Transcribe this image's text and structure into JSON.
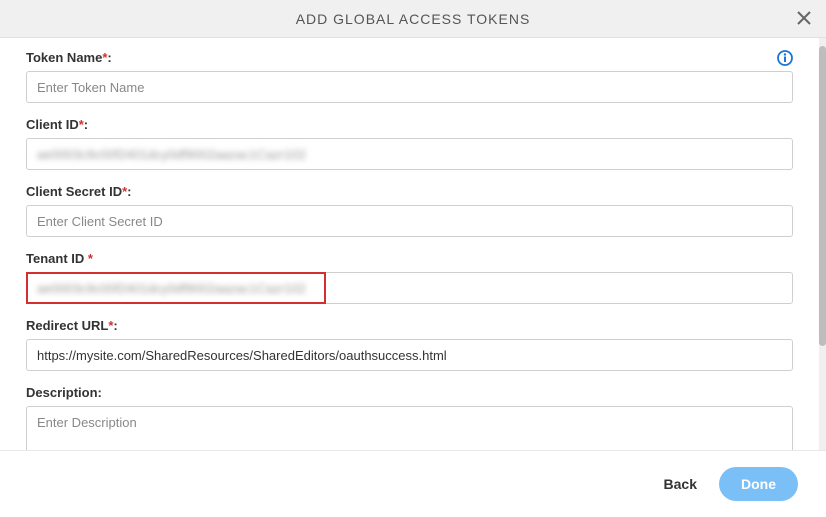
{
  "header": {
    "title": "ADD GLOBAL ACCESS TOKENS"
  },
  "form": {
    "token_name": {
      "label": "Token Name",
      "required_marker": "*",
      "colon": ":",
      "placeholder": "Enter Token Name",
      "value": ""
    },
    "client_id": {
      "label": "Client ID",
      "required_marker": "*",
      "colon": ":",
      "value_redacted": "ae0003c9c00f2401dcy0df9002aazac1Cazr102"
    },
    "client_secret": {
      "label": "Client Secret ID",
      "required_marker": "*",
      "colon": ":",
      "placeholder": "Enter Client Secret ID",
      "value": ""
    },
    "tenant_id": {
      "label": "Tenant ID ",
      "required_marker": "*",
      "value_redacted": "ae0003c9c00f2401dcy0df9002aazac1Cazr102"
    },
    "redirect_url": {
      "label": "Redirect URL",
      "required_marker": "*",
      "colon": ":",
      "value": "https://mysite.com/SharedResources/SharedEditors/oauthsuccess.html"
    },
    "description": {
      "label": "Description:",
      "placeholder": "Enter Description",
      "value": ""
    }
  },
  "footer": {
    "back_label": "Back",
    "done_label": "Done"
  }
}
